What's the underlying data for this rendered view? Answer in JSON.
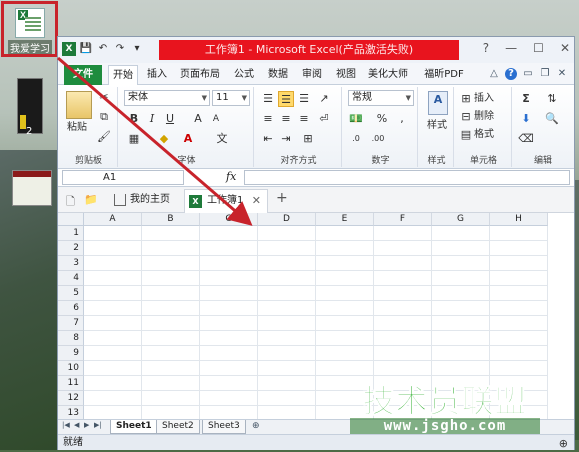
{
  "desktop": {
    "icon_label": "我爱学习",
    "thumb1_caption": "2",
    "thumb2_caption": "1"
  },
  "window": {
    "title": "工作簿1 - Microsoft Excel(产品激活失败)",
    "qat": [
      "X",
      "💾",
      "↶",
      "↷",
      "▾"
    ],
    "controls": [
      "?",
      "—",
      "☐",
      "✕"
    ]
  },
  "tabs": [
    {
      "label": "文件",
      "kind": "file"
    },
    {
      "label": "开始",
      "kind": "active"
    },
    {
      "label": "插入"
    },
    {
      "label": "页面布局"
    },
    {
      "label": "公式"
    },
    {
      "label": "数据"
    },
    {
      "label": "审阅"
    },
    {
      "label": "视图"
    },
    {
      "label": "美化大师"
    },
    {
      "label": "福昕PDF"
    }
  ],
  "ribbon": {
    "groups": [
      "剪贴板",
      "字体",
      "对齐方式",
      "数字",
      "样式",
      "单元格",
      "编辑"
    ],
    "paste_label": "粘贴",
    "font_name": "宋体",
    "font_size": "11",
    "number_format": "常规",
    "style_label": "样式",
    "cells": {
      "insert": "插入",
      "delete": "删除",
      "format": "格式"
    },
    "currency": "%",
    "comma": ","
  },
  "formula_bar": {
    "name_box": "A1",
    "fx": "fx",
    "value": ""
  },
  "doc_tabs": [
    {
      "label": "我的主页"
    },
    {
      "label": "工作簿1",
      "active": true
    }
  ],
  "grid": {
    "columns": [
      "A",
      "B",
      "C",
      "D",
      "E",
      "F",
      "G",
      "H"
    ],
    "rows": [
      "1",
      "2",
      "3",
      "4",
      "5",
      "6",
      "7",
      "8",
      "9",
      "10",
      "11",
      "12",
      "13"
    ]
  },
  "sheets": [
    "Sheet1",
    "Sheet2",
    "Sheet3"
  ],
  "status": {
    "text": "就绪"
  },
  "watermark": {
    "brand": "技术员联盟",
    "url": "www.jsgho.com"
  },
  "colors": {
    "title_red": "#e8141e",
    "file_green": "#1e8c3e",
    "arrow": "#c8232b"
  }
}
